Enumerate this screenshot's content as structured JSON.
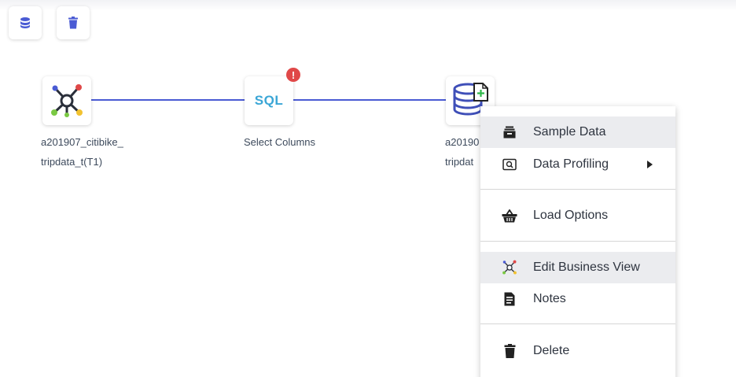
{
  "toolbar": {
    "items": [
      {
        "icon": "database-icon"
      },
      {
        "icon": "trash-icon"
      }
    ]
  },
  "nodes": [
    {
      "icon": "business-view-icon",
      "label_line1": "a201907_citibike_",
      "label_line2": "tripdata_t(T1)"
    },
    {
      "icon": "sql-icon",
      "icon_text": "SQL",
      "label_line1": "Select Columns",
      "label_line2": "",
      "badge": "!"
    },
    {
      "icon": "database-add-icon",
      "label_line1": "a20190",
      "label_line2": "tripdat"
    }
  ],
  "context_menu": {
    "items": [
      {
        "label": "Sample Data",
        "icon": "sample-data-icon",
        "highlighted": true
      },
      {
        "label": "Data Profiling",
        "icon": "data-profiling-icon",
        "submenu": true
      },
      {
        "label": "Load Options",
        "icon": "basket-icon"
      },
      {
        "label": "Edit Business View",
        "icon": "business-view-icon",
        "highlighted": true
      },
      {
        "label": "Notes",
        "icon": "notes-icon"
      },
      {
        "label": "Delete",
        "icon": "trash-icon"
      }
    ]
  },
  "colors": {
    "accent": "#4a5bd4",
    "error_badge": "#e04848",
    "sql_text": "#3aa6d6",
    "menu_highlight": "#ebecef"
  }
}
